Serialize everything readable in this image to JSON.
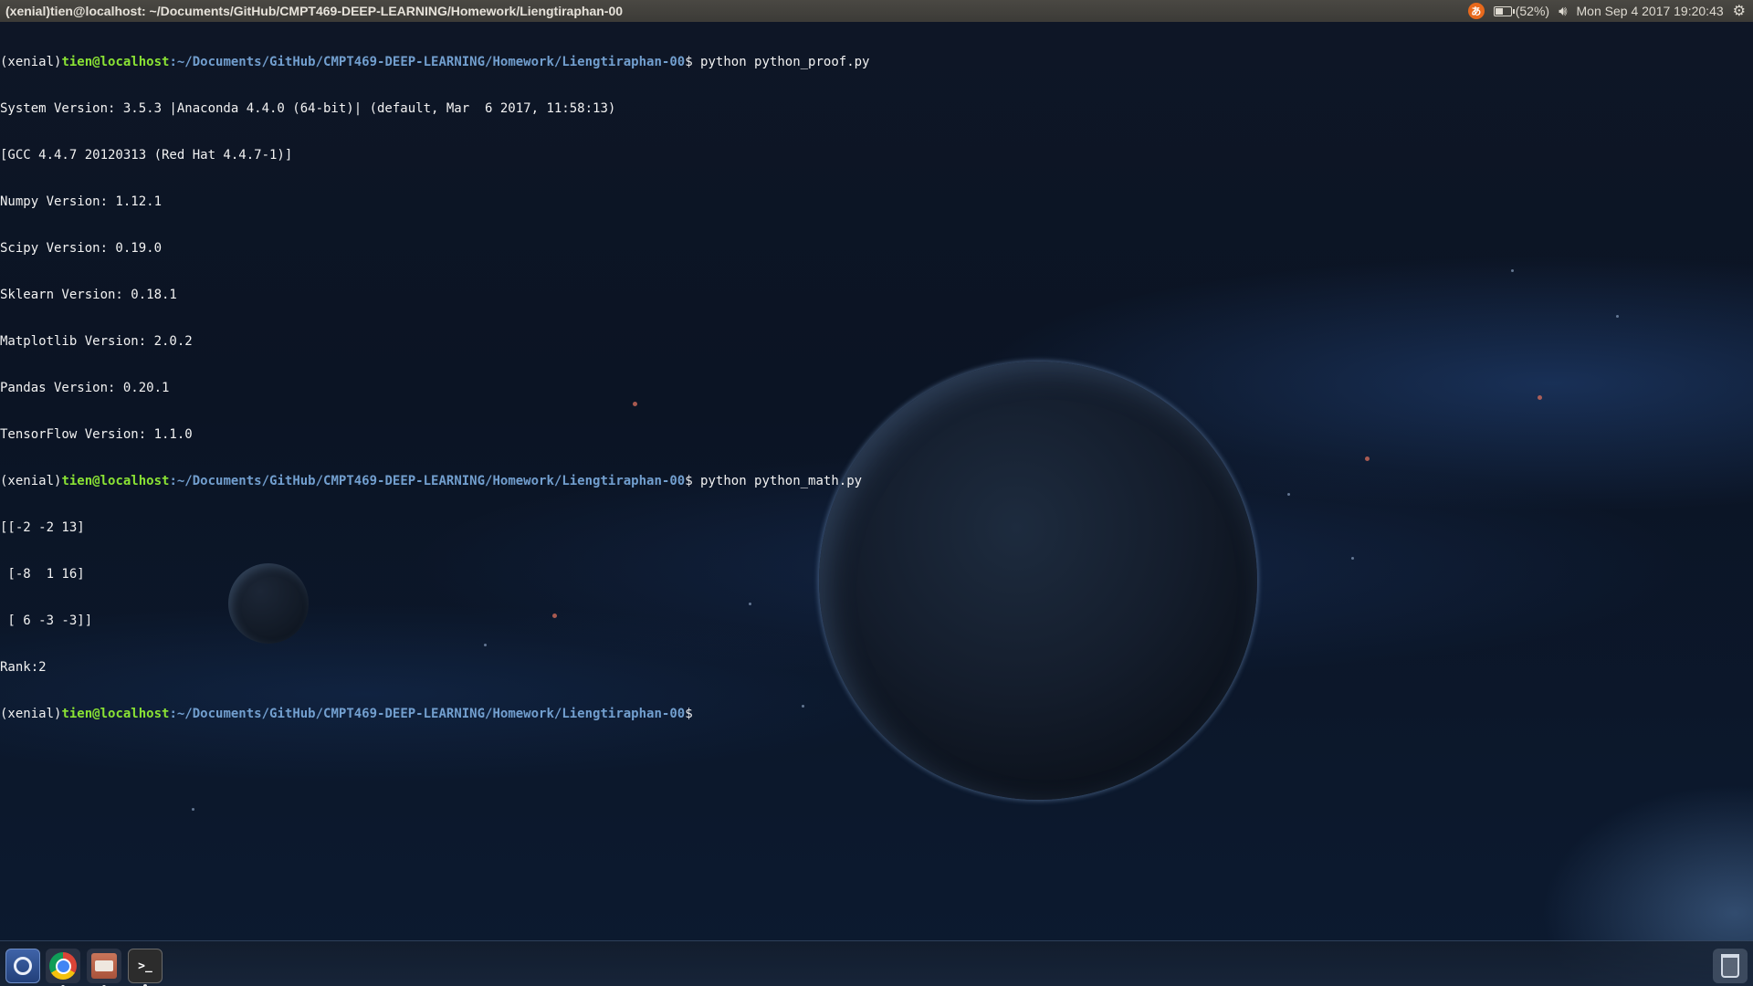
{
  "panel": {
    "window_title": "(xenial)tien@localhost: ~/Documents/GitHub/CMPT469-DEEP-LEARNING/Homework/Liengtiraphan-00",
    "ime_icon": "input-method-icon",
    "ime_glyph": "あ",
    "battery_percent": "(52%)",
    "battery_level": 0.52,
    "volume_icon": "speaker-icon",
    "clock": "Mon Sep 4 2017 19:20:43",
    "settings_icon": "gear-icon"
  },
  "terminal": {
    "env": "(xenial)",
    "user_host": "tien@localhost",
    "cwd": ":~/Documents/GitHub/CMPT469-DEEP-LEARNING/Homework/Liengtiraphan-00",
    "prompt_symbol": "$",
    "cmd1": " python python_proof.py",
    "output1": [
      "System Version: 3.5.3 |Anaconda 4.4.0 (64-bit)| (default, Mar  6 2017, 11:58:13)",
      "[GCC 4.4.7 20120313 (Red Hat 4.4.7-1)]",
      "Numpy Version: 1.12.1",
      "Scipy Version: 0.19.0",
      "Sklearn Version: 0.18.1",
      "Matplotlib Version: 2.0.2",
      "Pandas Version: 0.20.1",
      "TensorFlow Version: 1.1.0"
    ],
    "cmd2": " python python_math.py",
    "output2": [
      "[[-2 -2 13]",
      " [-8  1 16]",
      " [ 6 -3 -3]]",
      "Rank:2"
    ]
  },
  "dock": {
    "items": [
      {
        "name": "system-settings",
        "icon": "system-icon"
      },
      {
        "name": "chrome",
        "icon": "chrome-icon"
      },
      {
        "name": "files",
        "icon": "file-cabinet-icon"
      },
      {
        "name": "terminal",
        "icon": "terminal-icon",
        "glyph": ">_"
      },
      {
        "name": "trash",
        "icon": "trash-icon"
      }
    ]
  }
}
